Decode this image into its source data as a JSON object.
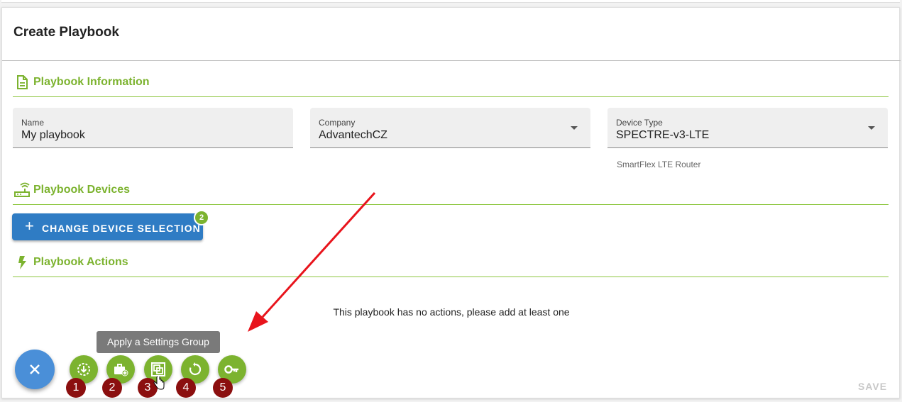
{
  "page": {
    "title": "Create Playbook"
  },
  "sections": {
    "info": {
      "label": "Playbook Information"
    },
    "devices": {
      "label": "Playbook Devices"
    },
    "actions": {
      "label": "Playbook Actions"
    }
  },
  "fields": {
    "name": {
      "label": "Name",
      "value": "My playbook"
    },
    "company": {
      "label": "Company",
      "value": "AdvantechCZ"
    },
    "device_type": {
      "label": "Device Type",
      "value": "SPECTRE-v3-LTE",
      "hint": "SmartFlex LTE Router"
    }
  },
  "change_button": {
    "label": "CHANGE DEVICE SELECTION",
    "badge": "2"
  },
  "actions_empty": "This playbook has no actions, please add at least one",
  "save_label": "SAVE",
  "tooltip": "Apply a Settings Group",
  "fab_actions": [
    {
      "icon": "download-circle-icon",
      "number": "1"
    },
    {
      "icon": "briefcase-add-icon",
      "number": "2"
    },
    {
      "icon": "settings-group-icon",
      "number": "3"
    },
    {
      "icon": "restart-icon",
      "number": "4"
    },
    {
      "icon": "key-icon",
      "number": "5"
    }
  ],
  "colors": {
    "accent": "#7cb32f",
    "primary": "#2f7cc4",
    "fab": "#4a8fd8",
    "marker": "#8b0f0f",
    "arrow": "#e8141c"
  }
}
